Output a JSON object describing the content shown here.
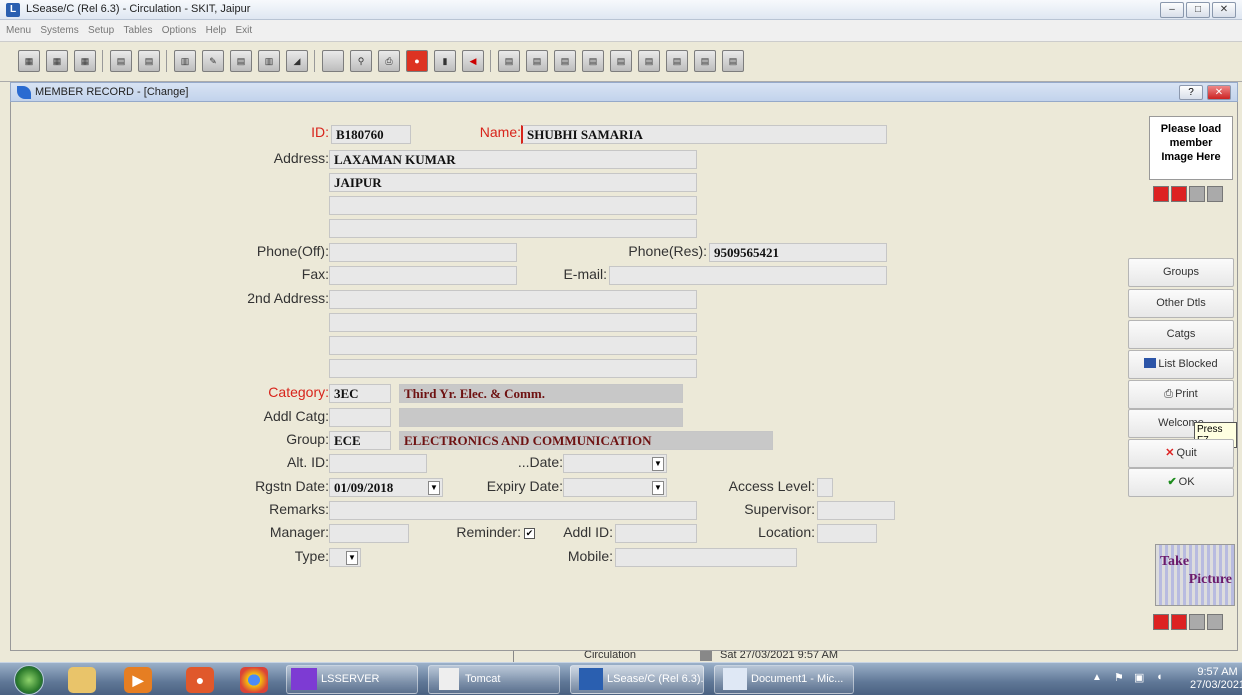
{
  "window": {
    "title": "LSease/C (Rel 6.3) - Circulation - SKIT, Jaipur"
  },
  "menu": [
    "Menu",
    "Systems",
    "Setup",
    "Tables",
    "Options",
    "Help",
    "Exit"
  ],
  "mdi": {
    "title": "MEMBER RECORD - [Change]",
    "help_label": "?",
    "close_label": "✕"
  },
  "form": {
    "id": {
      "label": "ID:",
      "value": "B180760"
    },
    "name": {
      "label": "Name:",
      "value": "SHUBHI SAMARIA"
    },
    "address": {
      "label": "Address:",
      "lines": [
        "LAXAMAN KUMAR",
        "JAIPUR",
        "",
        ""
      ]
    },
    "phone_off": {
      "label": "Phone(Off):",
      "value": ""
    },
    "phone_res": {
      "label": "Phone(Res):",
      "value": "9509565421"
    },
    "fax": {
      "label": "Fax:",
      "value": ""
    },
    "email": {
      "label": "E-mail:",
      "value": ""
    },
    "second_address": {
      "label": "2nd Address:",
      "lines": [
        "",
        "",
        "",
        ""
      ]
    },
    "category": {
      "label": "Category:",
      "code": "3EC",
      "desc": "Third Yr. Elec. & Comm."
    },
    "addl_catg": {
      "label": "Addl Catg:",
      "code": "",
      "desc": ""
    },
    "group": {
      "label": "Group:",
      "code": "ECE",
      "desc": "ELECTRONICS AND COMMUNICATION"
    },
    "alt_id": {
      "label": "Alt. ID:",
      "value": ""
    },
    "date": {
      "label": "...Date:",
      "value": ""
    },
    "rgstn_date": {
      "label": "Rgstn Date:",
      "value": "01/09/2018"
    },
    "expiry_date": {
      "label": "Expiry Date:",
      "value": ""
    },
    "access_level": {
      "label": "Access Level:",
      "value": ""
    },
    "remarks": {
      "label": "Remarks:",
      "value": ""
    },
    "supervisor": {
      "label": "Supervisor:",
      "value": ""
    },
    "manager": {
      "label": "Manager:",
      "value": ""
    },
    "reminder": {
      "label": "Reminder:",
      "checked": true,
      "mark": "✔"
    },
    "addl_id": {
      "label": "Addl ID:",
      "value": ""
    },
    "location": {
      "label": "Location:",
      "value": ""
    },
    "type": {
      "label": "Type:",
      "value": ""
    },
    "mobile": {
      "label": "Mobile:",
      "value": ""
    }
  },
  "image_panel": {
    "text_line1": "Please load",
    "text_line2": "member",
    "text_line3": "Image Here"
  },
  "take_picture": {
    "line1": "Take",
    "line2": "Picture"
  },
  "side_buttons": {
    "groups": "Groups",
    "other": "Other Dtls",
    "catgs": "Catgs",
    "list_blocked": "List Blocked",
    "print": "Print",
    "welcome": "Welcome",
    "tooltip": "Press F7",
    "quit": "Quit",
    "ok": "OK"
  },
  "status": {
    "module": "Circulation",
    "datetime": "Sat 27/03/2021 9:57 AM"
  },
  "taskbar": {
    "items": [
      "LSSERVER",
      "Tomcat",
      "LSease/C (Rel 6.3)...",
      "Document1 - Mic..."
    ],
    "time": "9:57 AM",
    "date": "27/03/2021"
  },
  "colors": {
    "form_bg": "#ECE9D8",
    "label_red": "#d8241b",
    "readonly_text": "#6e1212"
  }
}
